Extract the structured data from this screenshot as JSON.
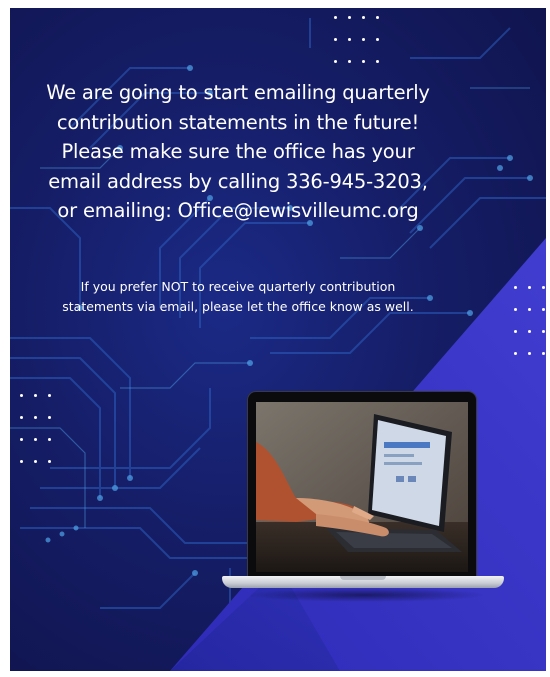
{
  "headline": {
    "lines": [
      "We are going to start emailing quarterly",
      "contribution statements in the future!",
      "Please make sure the office has your",
      "email address by calling 336-945-3203,",
      "or emailing: Office@lewisvilleumc.org"
    ]
  },
  "subtext": {
    "lines": [
      "If you prefer NOT to receive quarterly contribution",
      "statements via email, please let the office know as well."
    ]
  },
  "colors": {
    "background": "#151d66",
    "accent_panel": "#3a37c8",
    "text": "#ffffff"
  },
  "icons": {
    "decor_dots": "dot-grid-icon",
    "laptop": "laptop-icon"
  }
}
